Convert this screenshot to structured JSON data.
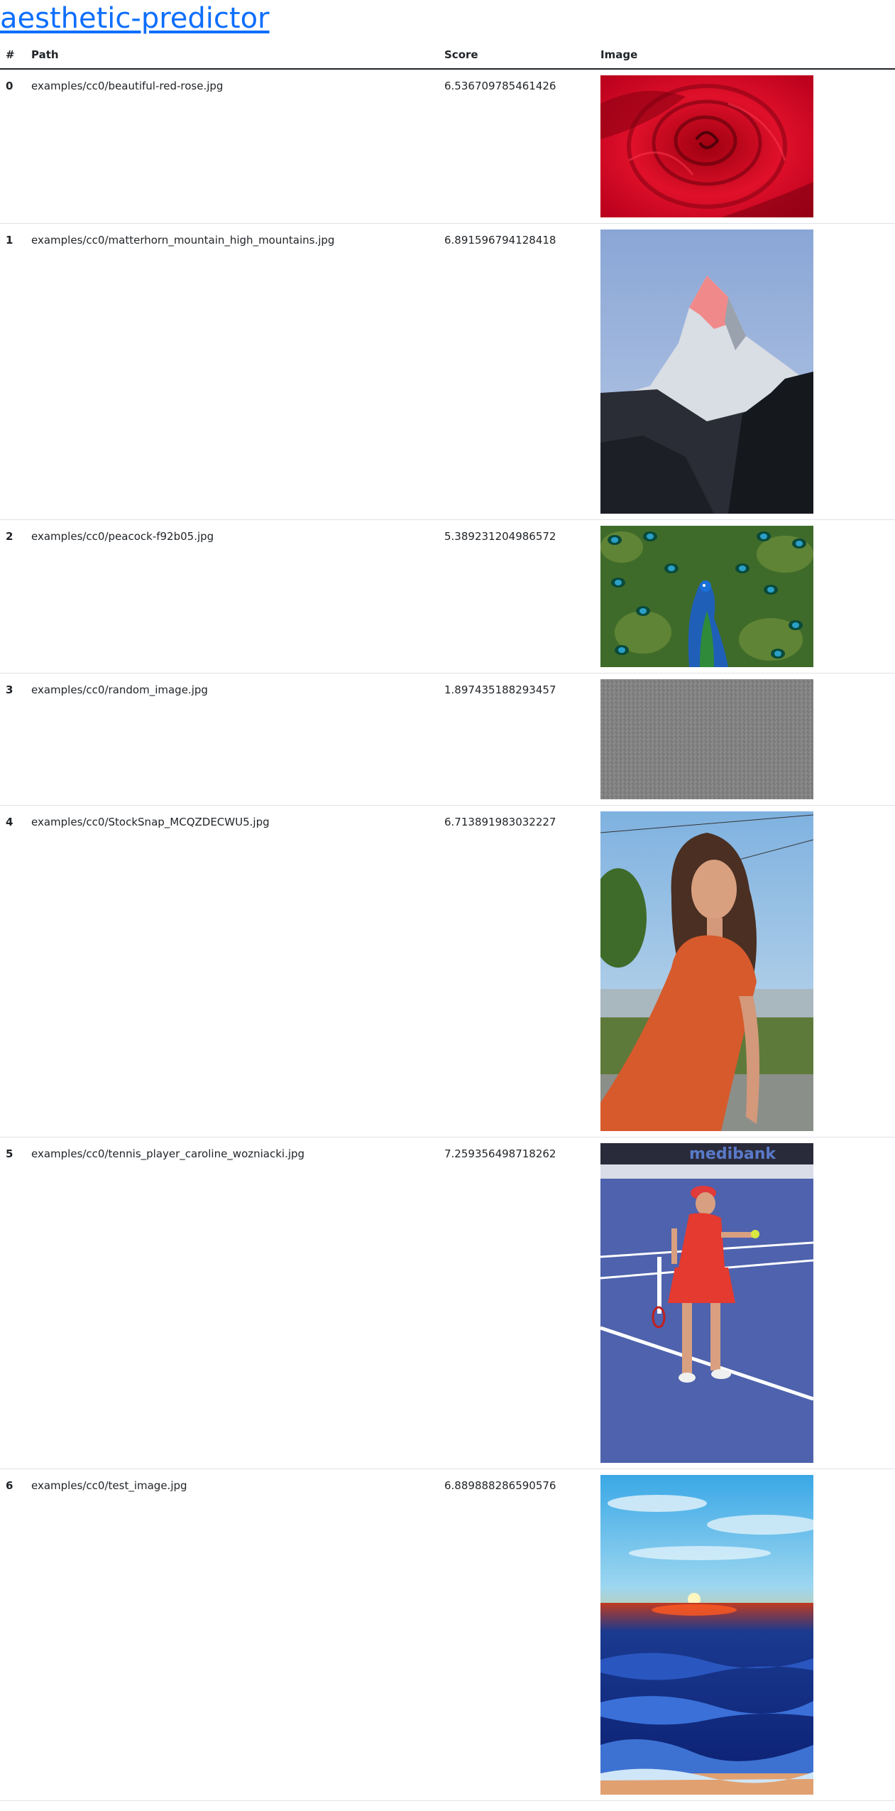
{
  "title": "aesthetic-predictor",
  "table": {
    "headers": {
      "index": "#",
      "path": "Path",
      "score": "Score",
      "image": "Image"
    },
    "rows": [
      {
        "index": "0",
        "path": "examples/cc0/beautiful-red-rose.jpg",
        "score": "6.536709785461426",
        "image": "rose-photo"
      },
      {
        "index": "1",
        "path": "examples/cc0/matterhorn_mountain_high_mountains.jpg",
        "score": "6.891596794128418",
        "image": "mountain-photo"
      },
      {
        "index": "2",
        "path": "examples/cc0/peacock-f92b05.jpg",
        "score": "5.389231204986572",
        "image": "peacock-photo"
      },
      {
        "index": "3",
        "path": "examples/cc0/random_image.jpg",
        "score": "1.897435188293457",
        "image": "noise-photo"
      },
      {
        "index": "4",
        "path": "examples/cc0/StockSnap_MCQZDECWU5.jpg",
        "score": "6.713891983032227",
        "image": "woman-orange-dress-photo"
      },
      {
        "index": "5",
        "path": "examples/cc0/tennis_player_caroline_wozniacki.jpg",
        "score": "7.259356498718262",
        "image": "tennis-player-photo",
        "image_text": "medibank"
      },
      {
        "index": "6",
        "path": "examples/cc0/test_image.jpg",
        "score": "6.889888286590576",
        "image": "sunset-ocean-photo"
      }
    ]
  }
}
